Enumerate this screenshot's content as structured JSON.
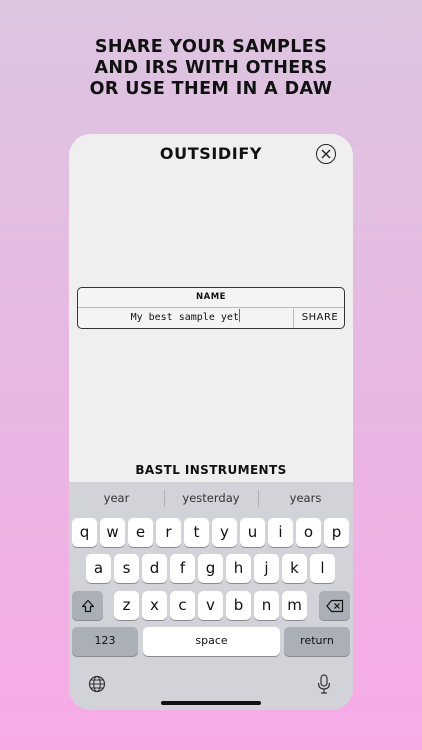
{
  "headline": [
    "SHARE YOUR SAMPLES",
    "AND IRS WITH OTHERS",
    "OR USE THEM IN A DAW"
  ],
  "app": {
    "title": "OUTSIDIFY",
    "name_label": "NAME",
    "name_value": "My best sample yet",
    "share_label": "SHARE",
    "brand": "BASTL INSTRUMENTS"
  },
  "keyboard": {
    "suggestions": [
      "year",
      "yesterday",
      "years"
    ],
    "row1": [
      "q",
      "w",
      "e",
      "r",
      "t",
      "y",
      "u",
      "i",
      "o",
      "p"
    ],
    "row2": [
      "a",
      "s",
      "d",
      "f",
      "g",
      "h",
      "j",
      "k",
      "l"
    ],
    "row3": [
      "z",
      "x",
      "c",
      "v",
      "b",
      "n",
      "m"
    ],
    "numbers_label": "123",
    "space_label": "space",
    "return_label": "return"
  },
  "icons": {
    "close": "close-icon",
    "shift": "shift-icon",
    "backspace": "backspace-icon",
    "globe": "globe-icon",
    "mic": "microphone-icon"
  },
  "colors": {
    "cursor": "#2a6ef0",
    "keyboard_bg": "#d1d3d8",
    "panel_bg": "#efefef"
  }
}
